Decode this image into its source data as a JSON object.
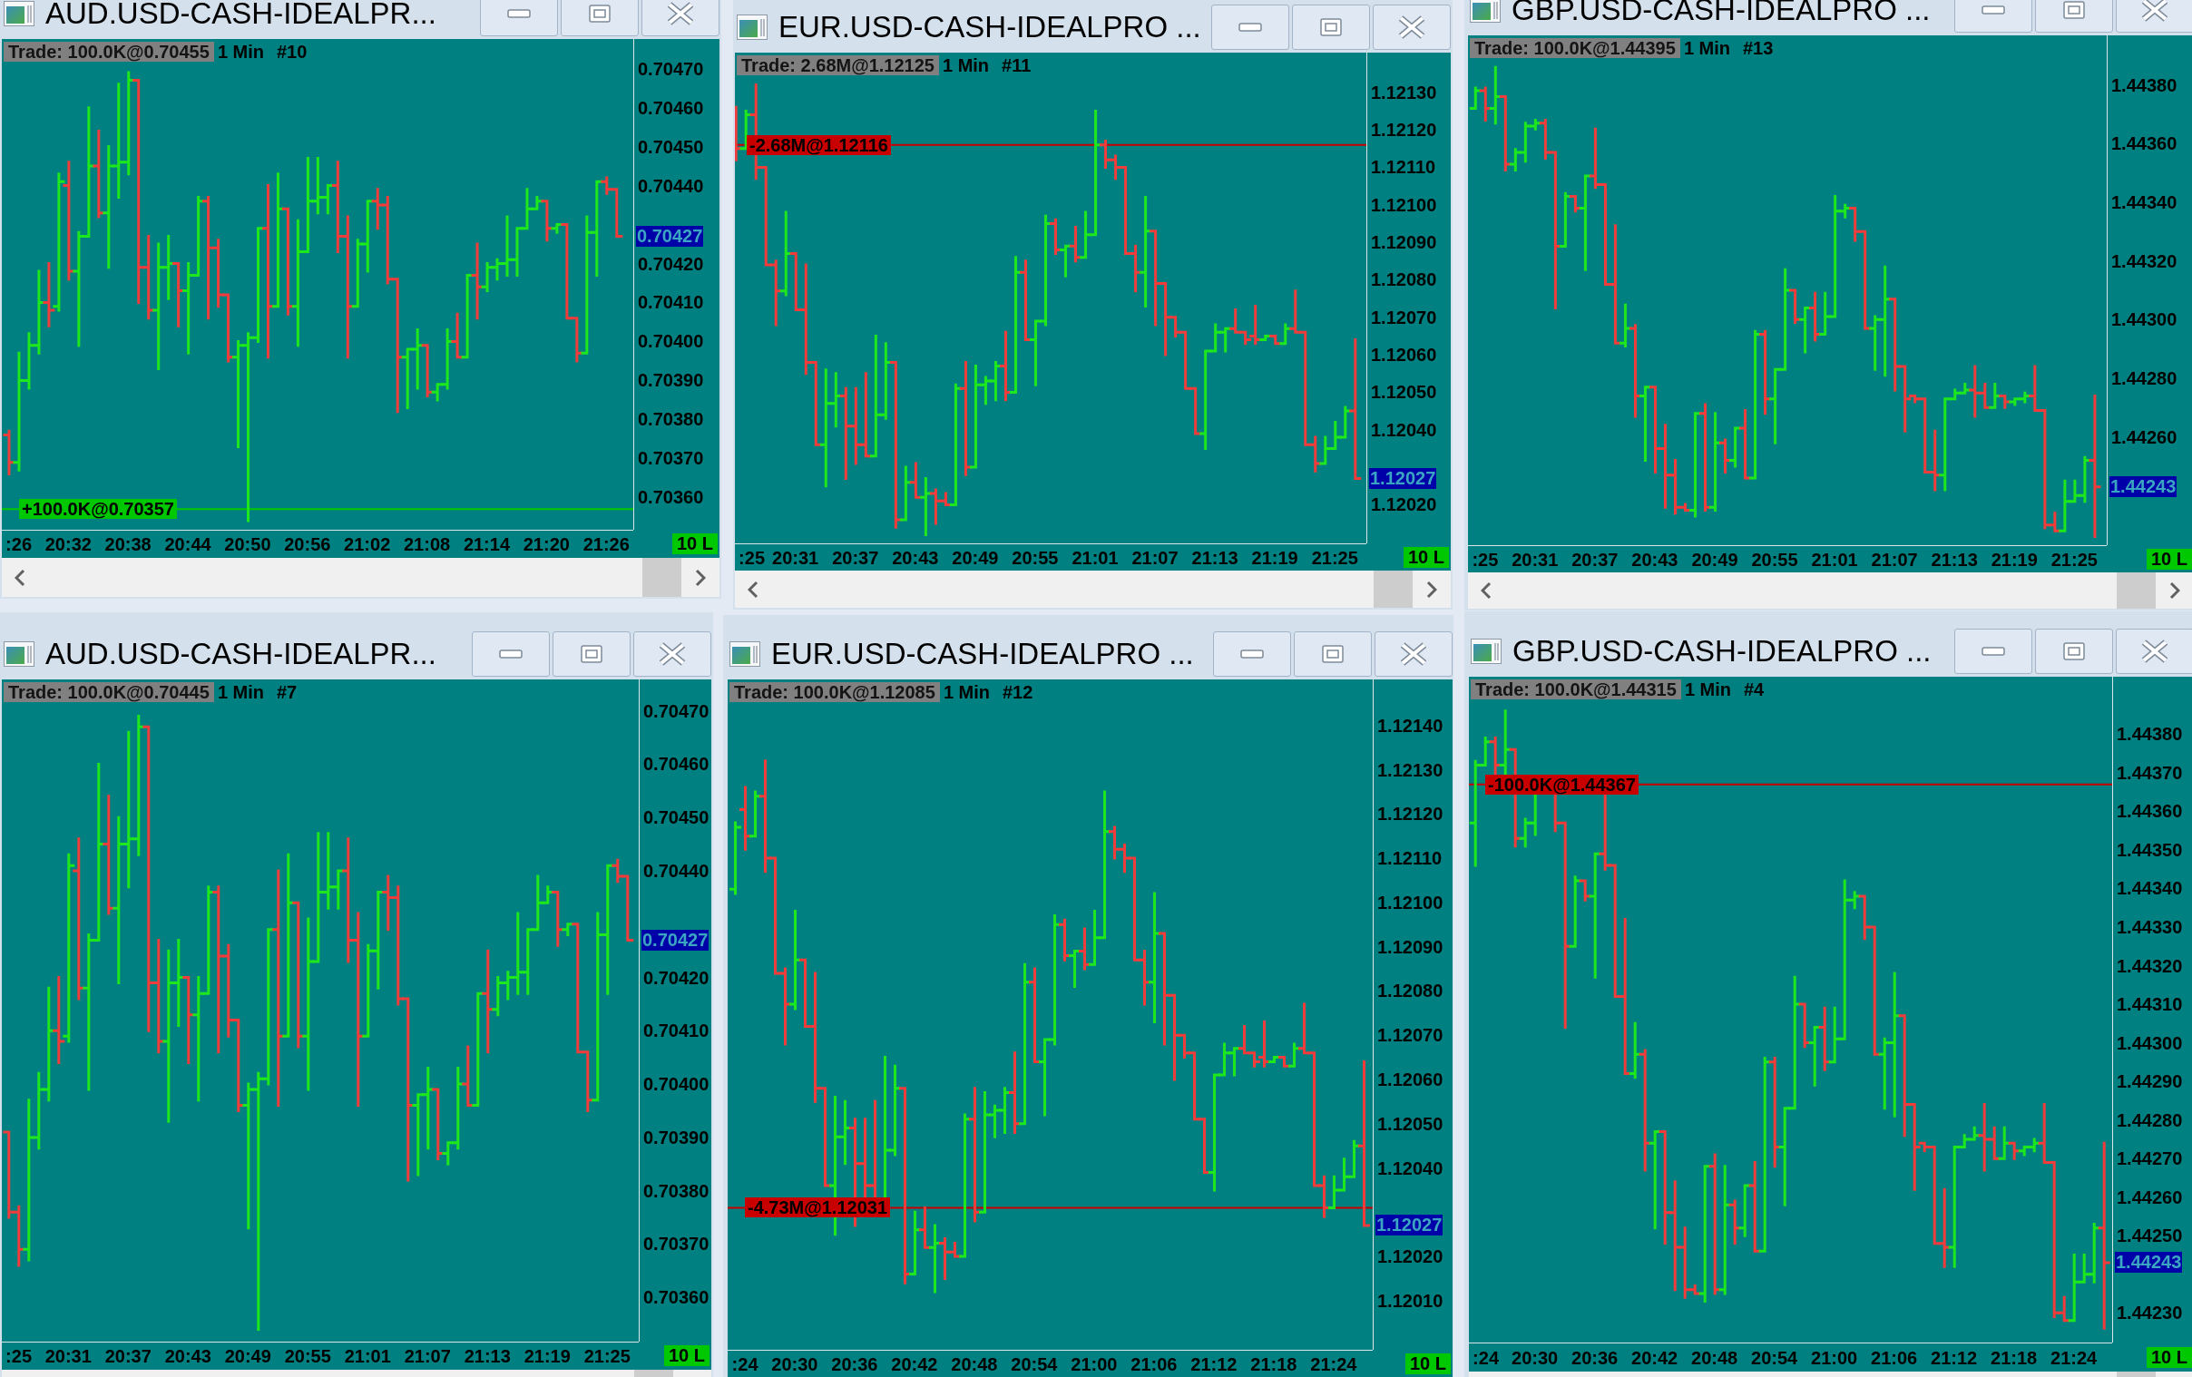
{
  "windows": [
    {
      "title": "AUD.USD-CASH-IDEALPR...",
      "trade": "Trade: 100.0K@0.70455",
      "interval": "1 Min",
      "chart_id": "#10",
      "last_price": "0.70427",
      "badge": "10 L",
      "chart_data": {
        "type": "line",
        "ylim": [
          0.703517,
          0.704776
        ],
        "categories": [
          ":26",
          null,
          null,
          null,
          null,
          null,
          "20:32",
          null,
          null,
          null,
          null,
          null,
          "20:38",
          null,
          null,
          null,
          null,
          null,
          "20:44",
          null,
          null,
          null,
          null,
          null,
          "20:50",
          null,
          null,
          null,
          null,
          null,
          "20:56",
          null,
          null,
          null,
          null,
          null,
          "21:02",
          null,
          null,
          null,
          null,
          null,
          "21:08",
          null,
          null,
          null,
          null,
          null,
          "21:14",
          null,
          null,
          null,
          null,
          null,
          "21:20",
          null,
          null,
          null,
          null,
          null,
          "21:26",
          null
        ],
        "yticks": [
          {
            "value": 0.7047,
            "label": "0.70470"
          },
          {
            "value": 0.7046,
            "label": "0.70460"
          },
          {
            "value": 0.7045,
            "label": "0.70450"
          },
          {
            "value": 0.7044,
            "label": "0.70440"
          },
          {
            "value": 0.7042,
            "label": "0.70420"
          },
          {
            "value": 0.7041,
            "label": "0.70410"
          },
          {
            "value": 0.704,
            "label": "0.70400"
          },
          {
            "value": 0.7039,
            "label": "0.70390"
          },
          {
            "value": 0.7038,
            "label": "0.70380"
          },
          {
            "value": 0.7037,
            "label": "0.70370"
          },
          {
            "value": 0.7036,
            "label": "0.70360"
          }
        ],
        "ref_lines": [
          {
            "axis": "y",
            "value": 0.70357,
            "label": "+100.0K@0.70357",
            "color": "#00c800"
          }
        ]
      }
    },
    {
      "title": "EUR.USD-CASH-IDEALPRO ...",
      "trade": "Trade: 2.68M@1.12125",
      "interval": "1 Min",
      "chart_id": "#11",
      "last_price": "1.12027",
      "badge": "10 L",
      "chart_data": {
        "type": "line",
        "ylim": [
          1.120097,
          1.121406
        ],
        "categories": [
          ":25",
          null,
          null,
          null,
          null,
          null,
          "20:31",
          null,
          null,
          null,
          null,
          null,
          "20:37",
          null,
          null,
          null,
          null,
          null,
          "20:43",
          null,
          null,
          null,
          null,
          null,
          "20:49",
          null,
          null,
          null,
          null,
          null,
          "20:55",
          null,
          null,
          null,
          null,
          null,
          "21:01",
          null,
          null,
          null,
          null,
          null,
          "21:07",
          null,
          null,
          null,
          null,
          null,
          "21:13",
          null,
          null,
          null,
          null,
          null,
          "21:19",
          null,
          null,
          null,
          null,
          null,
          "21:25",
          null,
          null
        ],
        "yticks": [
          {
            "value": 1.1213,
            "label": "1.12130"
          },
          {
            "value": 1.1212,
            "label": "1.12120"
          },
          {
            "value": 1.1211,
            "label": "1.12110"
          },
          {
            "value": 1.121,
            "label": "1.12100"
          },
          {
            "value": 1.1209,
            "label": "1.12090"
          },
          {
            "value": 1.1208,
            "label": "1.12080"
          },
          {
            "value": 1.1207,
            "label": "1.12070"
          },
          {
            "value": 1.1206,
            "label": "1.12060"
          },
          {
            "value": 1.1205,
            "label": "1.12050"
          },
          {
            "value": 1.1204,
            "label": "1.12040"
          },
          {
            "value": 1.1202,
            "label": "1.12020"
          }
        ],
        "ref_lines": [
          {
            "axis": "y",
            "value": 1.12116,
            "label": "-2.68M@1.12116",
            "color": "#c80000"
          }
        ]
      }
    },
    {
      "title": "GBP.USD-CASH-IDEALPRO ...",
      "trade": "Trade: 100.0K@1.44395",
      "interval": "1 Min",
      "chart_id": "#13",
      "last_price": "1.44243",
      "badge": "10 L",
      "chart_data": {
        "type": "line",
        "ylim": [
          1.442231,
          1.443969
        ],
        "categories": [
          ":25",
          null,
          null,
          null,
          null,
          null,
          "20:31",
          null,
          null,
          null,
          null,
          null,
          "20:37",
          null,
          null,
          null,
          null,
          null,
          "20:43",
          null,
          null,
          null,
          null,
          null,
          "20:49",
          null,
          null,
          null,
          null,
          null,
          "20:55",
          null,
          null,
          null,
          null,
          null,
          "21:01",
          null,
          null,
          null,
          null,
          null,
          "21:07",
          null,
          null,
          null,
          null,
          null,
          "21:13",
          null,
          null,
          null,
          null,
          null,
          "21:19",
          null,
          null,
          null,
          null,
          null,
          "21:25",
          null,
          null
        ],
        "yticks": [
          {
            "value": 1.4438,
            "label": "1.44380"
          },
          {
            "value": 1.4436,
            "label": "1.44360"
          },
          {
            "value": 1.4434,
            "label": "1.44340"
          },
          {
            "value": 1.4432,
            "label": "1.44320"
          },
          {
            "value": 1.443,
            "label": "1.44300"
          },
          {
            "value": 1.4428,
            "label": "1.44280"
          },
          {
            "value": 1.4426,
            "label": "1.44260"
          }
        ]
      }
    },
    {
      "title": "AUD.USD-CASH-IDEALPR...",
      "trade": "Trade: 100.0K@0.70445",
      "interval": "1 Min",
      "chart_id": "#7",
      "last_price": "0.70427",
      "badge": "10 L",
      "chart_data": {
        "type": "line",
        "ylim": [
          0.703517,
          0.704759
        ],
        "categories": [
          ":25",
          null,
          null,
          null,
          null,
          null,
          "20:31",
          null,
          null,
          null,
          null,
          null,
          "20:37",
          null,
          null,
          null,
          null,
          null,
          "20:43",
          null,
          null,
          null,
          null,
          null,
          "20:49",
          null,
          null,
          null,
          null,
          null,
          "20:55",
          null,
          null,
          null,
          null,
          null,
          "21:01",
          null,
          null,
          null,
          null,
          null,
          "21:07",
          null,
          null,
          null,
          null,
          null,
          "21:13",
          null,
          null,
          null,
          null,
          null,
          "21:19",
          null,
          null,
          null,
          null,
          null,
          "21:25",
          null,
          null
        ],
        "yticks": [
          {
            "value": 0.7047,
            "label": "0.70470"
          },
          {
            "value": 0.7046,
            "label": "0.70460"
          },
          {
            "value": 0.7045,
            "label": "0.70450"
          },
          {
            "value": 0.7044,
            "label": "0.70440"
          },
          {
            "value": 0.7042,
            "label": "0.70420"
          },
          {
            "value": 0.7041,
            "label": "0.70410"
          },
          {
            "value": 0.704,
            "label": "0.70400"
          },
          {
            "value": 0.7039,
            "label": "0.70390"
          },
          {
            "value": 0.7038,
            "label": "0.70380"
          },
          {
            "value": 0.7037,
            "label": "0.70370"
          },
          {
            "value": 0.7036,
            "label": "0.70360"
          }
        ]
      }
    },
    {
      "title": "EUR.USD-CASH-IDEALPRO ...",
      "trade": "Trade: 100.0K@1.12085",
      "interval": "1 Min",
      "chart_id": "#12",
      "last_price": "1.12027",
      "badge": "10 L",
      "chart_data": {
        "type": "line",
        "ylim": [
          1.119989,
          1.121504
        ],
        "categories": [
          ":24",
          null,
          null,
          null,
          null,
          null,
          "20:30",
          null,
          null,
          null,
          null,
          null,
          "20:36",
          null,
          null,
          null,
          null,
          null,
          "20:42",
          null,
          null,
          null,
          null,
          null,
          "20:48",
          null,
          null,
          null,
          null,
          null,
          "20:54",
          null,
          null,
          null,
          null,
          null,
          "21:00",
          null,
          null,
          null,
          null,
          null,
          "21:06",
          null,
          null,
          null,
          null,
          null,
          "21:12",
          null,
          null,
          null,
          null,
          null,
          "21:18",
          null,
          null,
          null,
          null,
          null,
          "21:24",
          null,
          null,
          null
        ],
        "yticks": [
          {
            "value": 1.1214,
            "label": "1.12140"
          },
          {
            "value": 1.1213,
            "label": "1.12130"
          },
          {
            "value": 1.1212,
            "label": "1.12120"
          },
          {
            "value": 1.1211,
            "label": "1.12110"
          },
          {
            "value": 1.121,
            "label": "1.12100"
          },
          {
            "value": 1.1209,
            "label": "1.12090"
          },
          {
            "value": 1.1208,
            "label": "1.12080"
          },
          {
            "value": 1.1207,
            "label": "1.12070"
          },
          {
            "value": 1.1206,
            "label": "1.12060"
          },
          {
            "value": 1.1205,
            "label": "1.12050"
          },
          {
            "value": 1.1204,
            "label": "1.12040"
          },
          {
            "value": 1.1202,
            "label": "1.12020"
          },
          {
            "value": 1.1201,
            "label": "1.12010"
          }
        ],
        "ref_lines": [
          {
            "axis": "y",
            "value": 1.12031,
            "label": "-4.73M@1.12031",
            "color": "#c80000"
          }
        ]
      }
    },
    {
      "title": "GBP.USD-CASH-IDEALPRO ...",
      "trade": "Trade: 100.0K@1.44315",
      "interval": "1 Min",
      "chart_id": "#4",
      "last_price": "1.44243",
      "badge": "10 L",
      "chart_data": {
        "type": "line",
        "ylim": [
          1.442223,
          1.443949
        ],
        "categories": [
          ":24",
          null,
          null,
          null,
          null,
          null,
          "20:30",
          null,
          null,
          null,
          null,
          null,
          "20:36",
          null,
          null,
          null,
          null,
          null,
          "20:42",
          null,
          null,
          null,
          null,
          null,
          "20:48",
          null,
          null,
          null,
          null,
          null,
          "20:54",
          null,
          null,
          null,
          null,
          null,
          "21:00",
          null,
          null,
          null,
          null,
          null,
          "21:06",
          null,
          null,
          null,
          null,
          null,
          "21:12",
          null,
          null,
          null,
          null,
          null,
          "21:18",
          null,
          null,
          null,
          null,
          null,
          "21:24",
          null,
          null,
          null
        ],
        "yticks": [
          {
            "value": 1.4438,
            "label": "1.44380"
          },
          {
            "value": 1.4437,
            "label": "1.44370"
          },
          {
            "value": 1.4436,
            "label": "1.44360"
          },
          {
            "value": 1.4435,
            "label": "1.44350"
          },
          {
            "value": 1.4434,
            "label": "1.44340"
          },
          {
            "value": 1.4433,
            "label": "1.44330"
          },
          {
            "value": 1.4432,
            "label": "1.44320"
          },
          {
            "value": 1.4431,
            "label": "1.44310"
          },
          {
            "value": 1.443,
            "label": "1.44300"
          },
          {
            "value": 1.4429,
            "label": "1.44290"
          },
          {
            "value": 1.4428,
            "label": "1.44280"
          },
          {
            "value": 1.4427,
            "label": "1.44270"
          },
          {
            "value": 1.4426,
            "label": "1.44260"
          },
          {
            "value": 1.4425,
            "label": "1.44250"
          },
          {
            "value": 1.4423,
            "label": "1.44230"
          }
        ],
        "ref_lines": [
          {
            "axis": "y",
            "value": 1.44367,
            "label": "-100.0K@1.44367",
            "color": "#c80000"
          }
        ]
      }
    }
  ]
}
